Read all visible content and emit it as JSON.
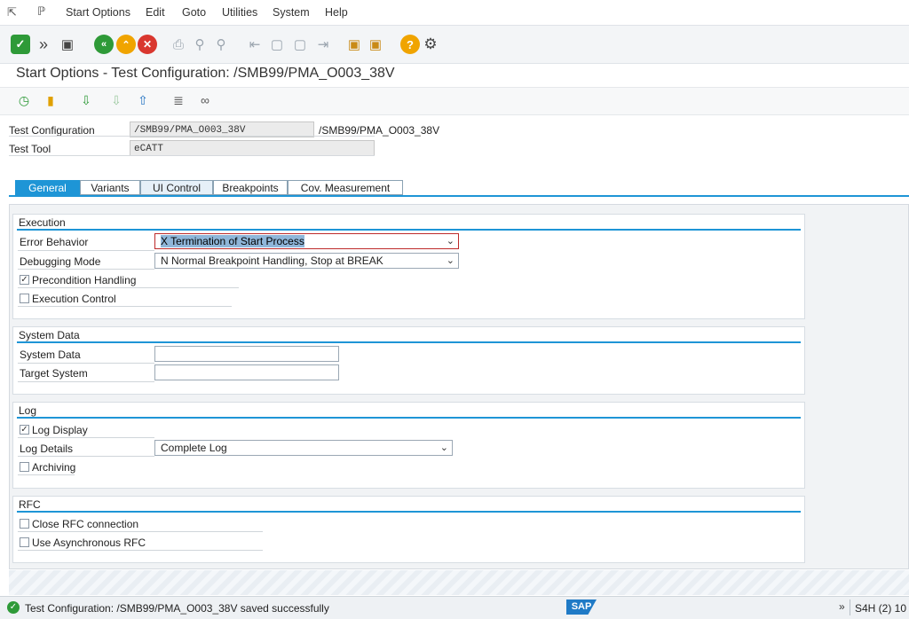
{
  "menu": {
    "items": [
      "Start Options",
      "Edit",
      "Goto",
      "Utilities",
      "System",
      "Help"
    ]
  },
  "toolbar": {
    "icons": [
      "check-icon",
      "double-arrow-icon",
      "save-icon",
      "back-icon",
      "exit-icon",
      "cancel-icon",
      "print-icon",
      "find-icon",
      "find-next-icon",
      "first-page-icon",
      "previous-page-icon",
      "next-page-icon",
      "last-page-icon",
      "create-session-icon",
      "shortcut-icon",
      "help-icon",
      "settings-icon"
    ]
  },
  "page": {
    "title": "Start Options - Test Configuration: /SMB99/PMA_O003_38V"
  },
  "header": {
    "test_configuration_label": "Test Configuration",
    "test_configuration_value": "/SMB99/PMA_O003_38V",
    "test_configuration_desc": "/SMB99/PMA_O003_38V",
    "test_tool_label": "Test Tool",
    "test_tool_value": "eCATT"
  },
  "tabs": [
    "General",
    "Variants",
    "UI Control",
    "Breakpoints",
    "Cov. Measurement"
  ],
  "execution": {
    "title": "Execution",
    "error_behavior_label": "Error Behavior",
    "error_behavior_value": "X Termination of Start Process",
    "debugging_mode_label": "Debugging Mode",
    "debugging_mode_value": "N Normal Breakpoint Handling, Stop at BREAK",
    "precondition_label": "Precondition Handling",
    "precondition_checked": true,
    "execution_control_label": "Execution Control",
    "execution_control_checked": false
  },
  "system_data": {
    "title": "System Data",
    "system_data_label": "System Data",
    "system_data_value": "",
    "target_system_label": "Target System",
    "target_system_value": ""
  },
  "log": {
    "title": "Log",
    "log_display_label": "Log Display",
    "log_display_checked": true,
    "log_details_label": "Log Details",
    "log_details_value": "Complete Log",
    "archiving_label": "Archiving",
    "archiving_checked": false
  },
  "rfc": {
    "title": "RFC",
    "close_rfc_label": "Close RFC connection",
    "close_rfc_checked": false,
    "async_rfc_label": "Use Asynchronous RFC",
    "async_rfc_checked": false
  },
  "status": {
    "message": "Test Configuration: /SMB99/PMA_O003_38V saved successfully",
    "logo": "SAP",
    "system": "S4H (2) 10"
  },
  "colors": {
    "accent": "#1e95d6",
    "success": "#2e9a38",
    "error": "#d9372f",
    "warning": "#f0a400"
  }
}
